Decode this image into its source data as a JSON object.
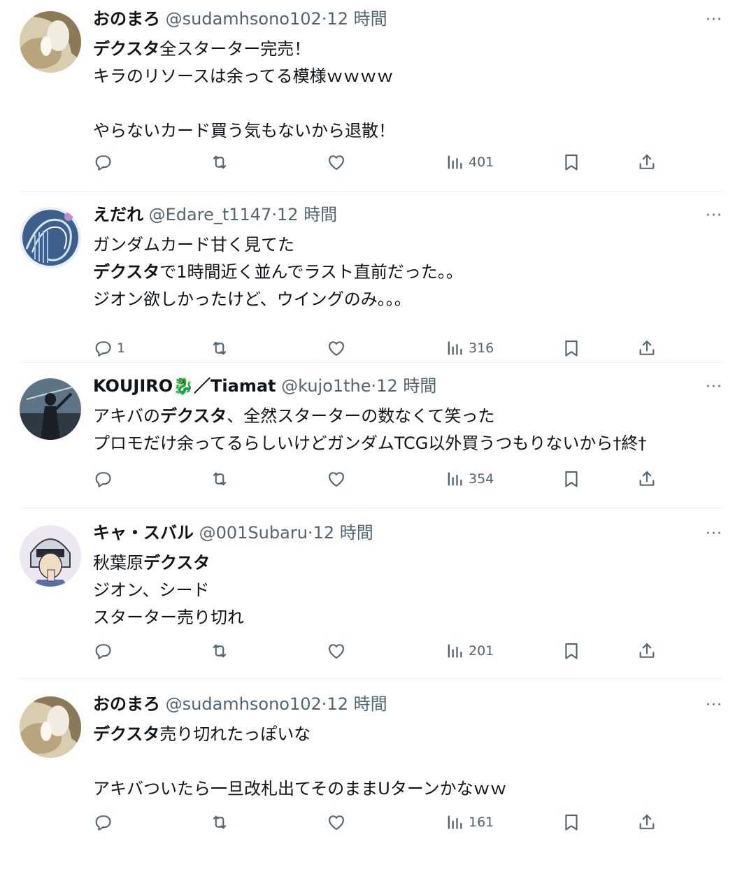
{
  "tweets": [
    {
      "name": "おのまろ",
      "handle": "@sudamhsono102",
      "time": "12 時間",
      "lines": [
        [
          {
            "t": "デクスタ",
            "b": true
          },
          {
            "t": "全スターター完売！"
          }
        ],
        [
          {
            "t": "キラのリソースは余ってる模様ｗｗｗｗ"
          }
        ],
        [],
        [
          {
            "t": "やらないカード買う気もないから退散！"
          }
        ]
      ],
      "replies": "",
      "views": "401",
      "avatar": "beige-cat"
    },
    {
      "name": "えだれ",
      "handle": "@Edare_t1147",
      "time": "12 時間",
      "lines": [
        [
          {
            "t": "ガンダムカード甘く見てた"
          }
        ],
        [
          {
            "t": "デクスタ",
            "b": true
          },
          {
            "t": "で1時間近く並んでラスト直前だった。。"
          }
        ],
        [
          {
            "t": "ジオン欲しかったけど、ウイングのみ。。。"
          }
        ]
      ],
      "replies": "1",
      "views": "316",
      "avatar": "blue-wave"
    },
    {
      "name": "KOUJIRO🐉／Tiamat",
      "handle": "@kujo1the",
      "time": "12 時間",
      "lines": [
        [
          {
            "t": "アキバの"
          },
          {
            "t": "デクスタ",
            "b": true
          },
          {
            "t": "、全然スターターの数なくて笑った"
          }
        ],
        [
          {
            "t": "プロモだけ余ってるらしいけどガンダムTCG以外買うつもりないから"
          },
          {
            "t": "†終†"
          }
        ]
      ],
      "replies": "",
      "views": "354",
      "avatar": "dark-figure"
    },
    {
      "name": "キャ・スバル",
      "handle": "@001Subaru",
      "time": "12 時間",
      "lines": [
        [
          {
            "t": "秋葉原"
          },
          {
            "t": "デクスタ",
            "b": true
          }
        ],
        [
          {
            "t": "ジオン、シード"
          }
        ],
        [
          {
            "t": "スターター売り切れ"
          }
        ]
      ],
      "replies": "",
      "views": "201",
      "avatar": "masked-character"
    },
    {
      "name": "おのまろ",
      "handle": "@sudamhsono102",
      "time": "12 時間",
      "lines": [
        [
          {
            "t": "デクスタ",
            "b": true
          },
          {
            "t": "売り切れたっぽいな"
          }
        ],
        [],
        [
          {
            "t": "アキバついたら一旦改札出てそのままUターンかなｗｗ"
          }
        ]
      ],
      "replies": "",
      "views": "161",
      "avatar": "beige-cat"
    }
  ],
  "icons": {
    "reply": "reply-icon",
    "retweet": "retweet-icon",
    "like": "heart-icon",
    "views": "views-icon",
    "bookmark": "bookmark-icon",
    "share": "share-icon",
    "more": "more-icon"
  },
  "colors": {
    "text": "#0f1419",
    "secondary": "#536471",
    "divider": "#eff3f4"
  }
}
